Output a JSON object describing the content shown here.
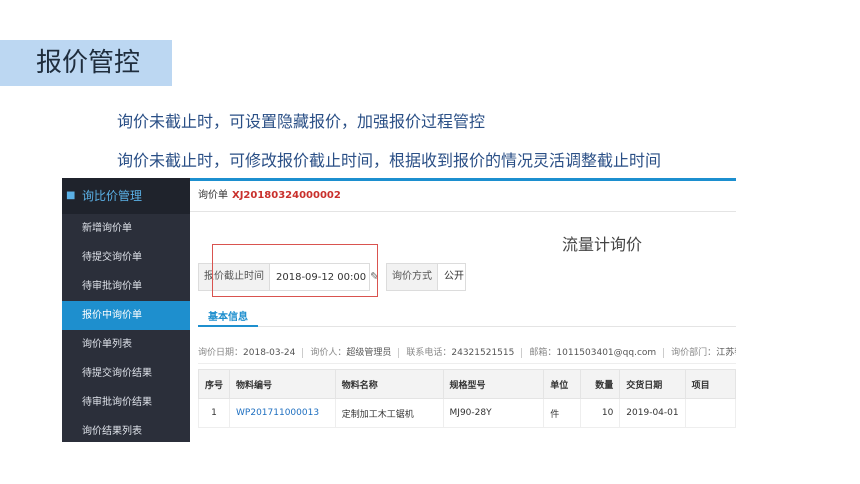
{
  "slide": {
    "title": "报价管控",
    "bullets": [
      "询价未截止时，可设置隐藏报价，加强报价过程管控",
      "询价未截止时，可修改报价截止时间，根据收到报价的情况灵活调整截止时间"
    ]
  },
  "sidebar": {
    "header": "询比价管理",
    "items": [
      {
        "label": "新增询价单"
      },
      {
        "label": "待提交询价单"
      },
      {
        "label": "待审批询价单"
      },
      {
        "label": "报价中询价单"
      },
      {
        "label": "询价单列表"
      },
      {
        "label": "待提交询价结果"
      },
      {
        "label": "待审批询价结果"
      },
      {
        "label": "询价结果列表"
      }
    ],
    "active_index": 3
  },
  "inquiry": {
    "label": "询价单",
    "code": "XJ20180324000002",
    "title": "流量计询价",
    "deadline_label": "报价截止时间",
    "deadline_value": "2018-09-12 00:00",
    "method_label": "询价方式",
    "method_value": "公开",
    "tab_basic": "基本信息",
    "info": {
      "date_label": "询价日期：",
      "date_value": "2018-03-24",
      "person_label": "询价人：",
      "person_value": "超级管理员",
      "phone_label": "联系电话：",
      "phone_value": "24321521515",
      "email_label": "邮箱：",
      "email_value": "1011503401@qq.com",
      "dept_label": "询价部门：",
      "dept_value": "江苏莓客易行网络"
    }
  },
  "table": {
    "headers": [
      "序号",
      "物料编号",
      "物料名称",
      "规格型号",
      "单位",
      "数量",
      "交货日期",
      "项目"
    ],
    "rows": [
      [
        "1",
        "WP201711000013",
        "定制加工木工锯机",
        "MJ90-28Y",
        "件",
        "10",
        "2019-04-01",
        ""
      ]
    ]
  },
  "colors": {
    "accent": "#1e8fce",
    "highlight_box": "#d9534f",
    "code_red": "#c9302c",
    "title_box": "#bcd7f2"
  }
}
